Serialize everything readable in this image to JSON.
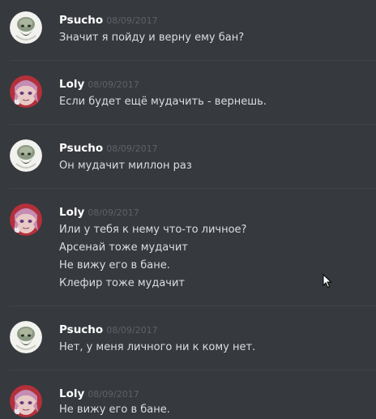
{
  "messages": [
    {
      "author": "Psucho",
      "timestamp": "08/09/2017",
      "avatar": "psucho-avatar",
      "lines": [
        "Значит я пойду и верну ему бан?"
      ]
    },
    {
      "author": "Loly",
      "timestamp": "08/09/2017",
      "avatar": "loly-avatar",
      "lines": [
        "Если будет ещё мудачить - вернешь."
      ]
    },
    {
      "author": "Psucho",
      "timestamp": "08/09/2017",
      "avatar": "psucho-avatar",
      "lines": [
        "Он мудачит миллон раз"
      ]
    },
    {
      "author": "Loly",
      "timestamp": "08/09/2017",
      "avatar": "loly-avatar",
      "lines": [
        "Или у тебя к нему что-то личное?",
        "Арсенай тоже мудачит",
        "Не вижу его в бане.",
        "Клефир тоже мудачит"
      ]
    },
    {
      "author": "Psucho",
      "timestamp": "08/09/2017",
      "avatar": "psucho-avatar",
      "lines": [
        "Нет, у меня личного ни к кому нет."
      ]
    },
    {
      "author": "Loly",
      "timestamp": "08/09/2017",
      "avatar": "loly-avatar",
      "lines": [
        "Не вижу его в бане."
      ]
    }
  ],
  "colors": {
    "background": "#36393e",
    "divider": "#3f4247",
    "username": "#ffffff",
    "timestamp": "#5f6166",
    "message_text": "#dcddde"
  },
  "cursor": "mouse-pointer-icon"
}
